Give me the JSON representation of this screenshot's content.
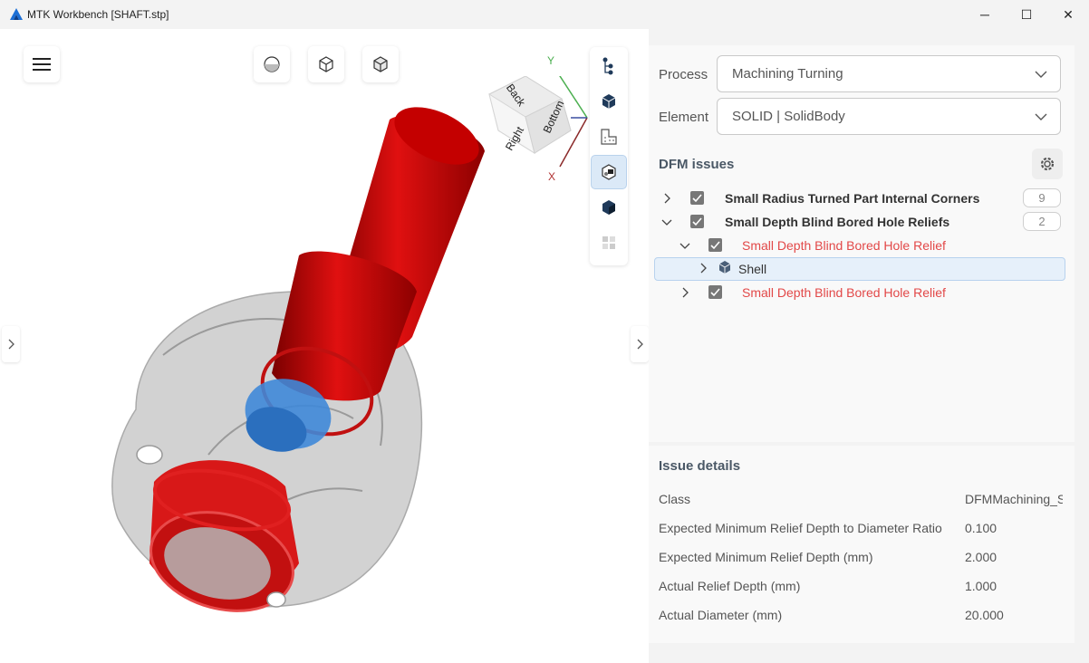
{
  "window": {
    "title": "MTK Workbench [SHAFT.stp]",
    "minimize_glyph": "─",
    "maximize_glyph": "☐",
    "close_glyph": "✕"
  },
  "viewcube": {
    "faces": [
      "Back",
      "Bottom",
      "Right"
    ],
    "axes": [
      "Y",
      "X"
    ]
  },
  "panel": {
    "process_label": "Process",
    "process_value": "Machining Turning",
    "element_label": "Element",
    "element_value": "SOLID | SolidBody",
    "issues_title": "DFM issues",
    "issues": [
      {
        "label": "Small Radius Turned Part Internal Corners",
        "count": "9"
      },
      {
        "label": "Small Depth Blind Bored Hole Reliefs",
        "count": "2"
      },
      {
        "label": "Small Depth Blind Bored Hole Relief"
      },
      {
        "label": "Shell"
      },
      {
        "label": "Small Depth Blind Bored Hole Relief"
      }
    ],
    "details_title": "Issue details",
    "details": [
      {
        "label": "Class",
        "value": "DFMMachining_S"
      },
      {
        "label": "Expected Minimum Relief Depth to Diameter Ratio",
        "value": "0.100"
      },
      {
        "label": "Expected Minimum Relief Depth (mm)",
        "value": "2.000"
      },
      {
        "label": "Actual Relief Depth (mm)",
        "value": "1.000"
      },
      {
        "label": "Actual Diameter (mm)",
        "value": "20.000"
      }
    ]
  },
  "colors": {
    "highlight_red": "#e24848",
    "selection_blue": "#3f88d8",
    "model_gray": "#b9b9b9"
  }
}
